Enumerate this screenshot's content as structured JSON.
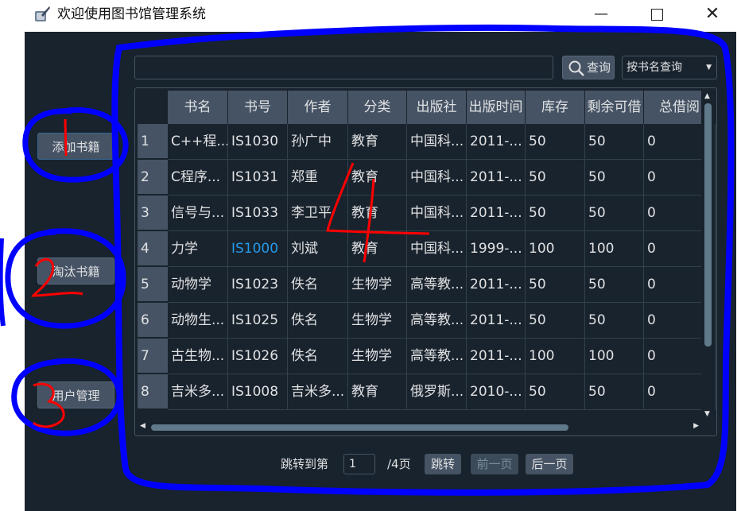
{
  "window": {
    "title": "欢迎使用图书馆管理系统",
    "controls": {
      "minimize": "—",
      "close": "✕"
    }
  },
  "sidebar": {
    "add_books": "添加书籍",
    "remove_books": "淘汰书籍",
    "user_management": "用户管理"
  },
  "search": {
    "input_value": "",
    "button_label": "查询",
    "mode_selected": "按书名查询"
  },
  "table": {
    "columns": [
      "书名",
      "书号",
      "作者",
      "分类",
      "出版社",
      "出版时间",
      "库存",
      "剩余可借",
      "总借阅"
    ],
    "rows": [
      {
        "num": "1",
        "cells": [
          "C++程...",
          "IS1030",
          "孙广中",
          "教育",
          "中国科...",
          "2011-...",
          "50",
          "50",
          "0"
        ]
      },
      {
        "num": "2",
        "cells": [
          "C程序...",
          "IS1031",
          "郑重",
          "教育",
          "中国科...",
          "2011-...",
          "50",
          "50",
          "0"
        ]
      },
      {
        "num": "3",
        "cells": [
          "信号与...",
          "IS1033",
          "李卫平",
          "教育",
          "中国科...",
          "2011-...",
          "50",
          "50",
          "0"
        ]
      },
      {
        "num": "4",
        "cells": [
          "力学",
          "IS1000",
          "刘斌",
          "教育",
          "中国科...",
          "1999-...",
          "100",
          "100",
          "0"
        ]
      },
      {
        "num": "5",
        "cells": [
          "动物学",
          "IS1023",
          "佚名",
          "生物学",
          "高等教...",
          "2011-...",
          "50",
          "50",
          "0"
        ]
      },
      {
        "num": "6",
        "cells": [
          "动物生...",
          "IS1025",
          "佚名",
          "生物学",
          "高等教...",
          "2011-...",
          "50",
          "50",
          "0"
        ]
      },
      {
        "num": "7",
        "cells": [
          "古生物...",
          "IS1026",
          "佚名",
          "生物学",
          "高等教...",
          "2011-...",
          "100",
          "100",
          "0"
        ]
      },
      {
        "num": "8",
        "cells": [
          "吉米多...",
          "IS1008",
          "吉米多...",
          "教育",
          "俄罗斯...",
          "2010-...",
          "50",
          "50",
          "0"
        ]
      }
    ],
    "selected_cell": {
      "row": 3,
      "col": 1
    }
  },
  "pagination": {
    "jump_label": "跳转到第",
    "current_page": "1",
    "total_label": "/4页",
    "jump_button": "跳转",
    "prev_button": "前一页",
    "next_button": "后一页"
  },
  "annotations": [
    "1",
    "2",
    "3",
    "4"
  ],
  "colors": {
    "background": "#19232d",
    "control": "#455364",
    "text": "#e0e1e3",
    "selected_text": "#259ae9",
    "annotation_blue": "#0000ff",
    "annotation_red": "#ff0000"
  }
}
